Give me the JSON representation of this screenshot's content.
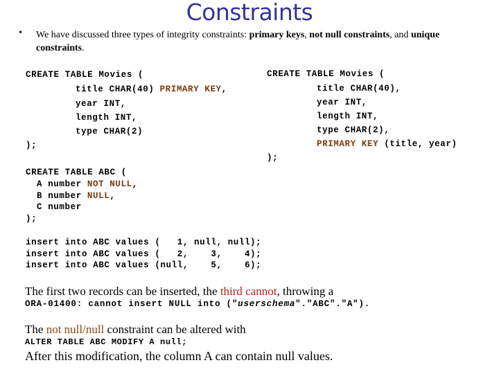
{
  "slide": {
    "title": "Constraints",
    "intro": {
      "bullet": "•",
      "text_before": "We have discussed three types of integrity constraints: ",
      "bold1": "primary keys",
      "sep1": ", ",
      "bold2": "not null constraints",
      "sep2": ", and ",
      "bold3": "unique constraints",
      "end": "."
    },
    "movies_left": {
      "line1": "CREATE TABLE Movies (",
      "line2_pre": "title CHAR(40) ",
      "line2_kw": "PRIMARY KEY",
      "line2_post": ",",
      "line3": "year INT,",
      "line4": "length INT,",
      "line5": "type CHAR(2)",
      "line6": ");"
    },
    "movies_right": {
      "line1": "CREATE TABLE Movies (",
      "line2": "title CHAR(40),",
      "line3": "year INT,",
      "line4": "length INT,",
      "line5": "type CHAR(2),",
      "line6_kw": "PRIMARY KEY",
      "line6_post": " (title, year)",
      "line7": ");"
    },
    "abc": {
      "line1": "CREATE TABLE ABC (",
      "line2_pre": "A number ",
      "line2_kw": "NOT NULL",
      "line2_post": ",",
      "line3_pre": "B number ",
      "line3_kw": "NULL",
      "line3_post": ",",
      "line4": "C number",
      "line5": ");"
    },
    "inserts": [
      "insert into ABC values (   1, null, null);",
      "insert into ABC values (   2,    3,    4);",
      "insert into ABC values (null,    5,    6);"
    ],
    "result": {
      "pre": "The first two records can be inserted, the ",
      "highlight": "third cannot",
      "post": ", throwing a",
      "error_pre": "ORA-01400: cannot insert NULL into (\"",
      "error_schema": "userschema",
      "error_post": "\".\"ABC\".\"A\")."
    },
    "alter": {
      "pre": "The ",
      "highlight": "not null/null",
      "post": " constraint can be altered with",
      "statement": "ALTER TABLE ABC MODIFY A null;",
      "after": "After this modification, the column A can contain null values."
    },
    "colors": {
      "title": "#333399",
      "keyword": "#7a3a10",
      "third_cannot": "#b22222",
      "not_null_null": "#8b4513"
    }
  }
}
